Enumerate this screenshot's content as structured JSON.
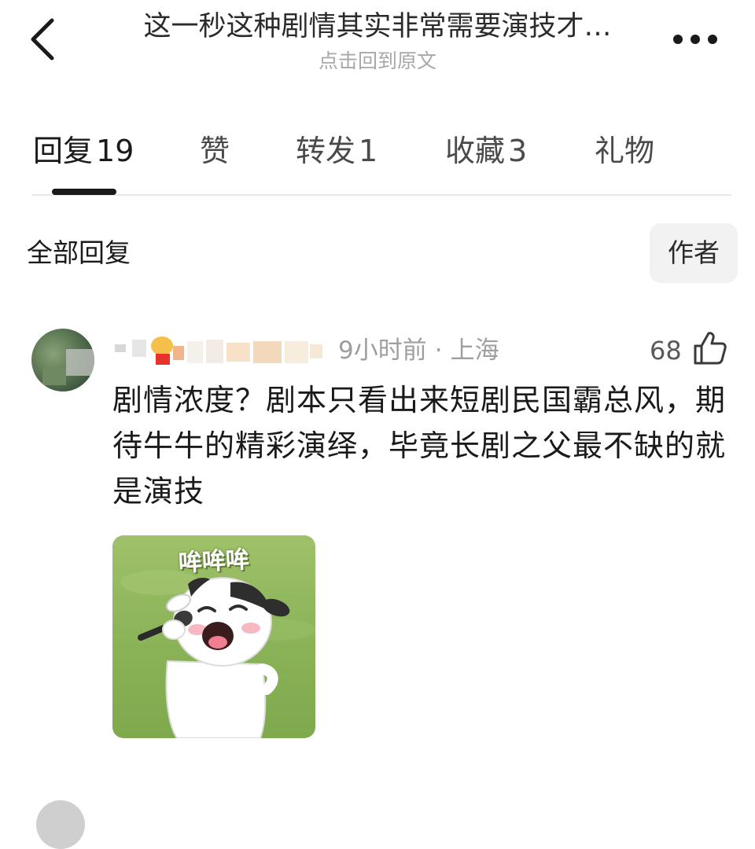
{
  "header": {
    "title": "这一秒这种剧情其实非常需要演技才…",
    "subtitle": "点击回到原文"
  },
  "tabs": [
    {
      "label": "回复",
      "count": "19",
      "active": true
    },
    {
      "label": "赞",
      "count": "",
      "active": false
    },
    {
      "label": "转发",
      "count": "1",
      "active": false
    },
    {
      "label": "收藏",
      "count": "3",
      "active": false
    },
    {
      "label": "礼物",
      "count": "",
      "active": false
    }
  ],
  "filter": {
    "all_label": "全部回复",
    "author_label": "作者"
  },
  "comment": {
    "time": "9小时前",
    "separator": "·",
    "location": "上海",
    "likes": "68",
    "text": "剧情浓度？剧本只看出来短剧民国霸总风，期待牛牛的精彩演绎，毕竟长剧之父最不缺的就是演技",
    "sticker_caption": "哞哞哞"
  },
  "icons": {
    "back": "chevron-left-icon",
    "more": "more-dots-icon",
    "like": "thumbs-up-icon"
  },
  "colors": {
    "text": "#1a1a1a",
    "muted": "#9e9e9e",
    "sticker_bg": "#8db55a"
  }
}
